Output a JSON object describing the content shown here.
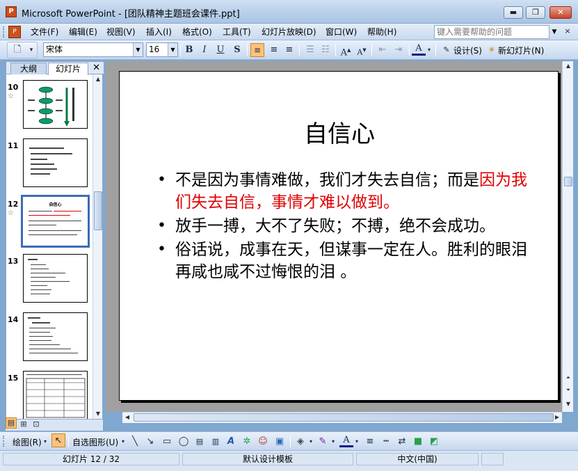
{
  "window": {
    "title": "Microsoft PowerPoint - [团队精神主题班会课件.ppt]",
    "app_icon": "powerpoint-icon",
    "minimize_label": "▬",
    "maximize_label": "❐",
    "close_label": "✕"
  },
  "menu": {
    "items": [
      "文件(F)",
      "编辑(E)",
      "视图(V)",
      "插入(I)",
      "格式(O)",
      "工具(T)",
      "幻灯片放映(D)",
      "窗口(W)",
      "帮助(H)"
    ],
    "help_placeholder": "键入需要帮助的问题"
  },
  "toolbar": {
    "font_name": "宋体",
    "font_size": "16",
    "bold": "B",
    "italic": "I",
    "underline": "U",
    "shadow": "S",
    "design_label": "设计(S)",
    "new_slide_label": "新幻灯片(N)"
  },
  "outline_pane": {
    "tabs": [
      "大纲",
      "幻灯片"
    ],
    "selected_tab": "幻灯片",
    "close_label": "✕",
    "thumbnails": [
      {
        "number": "10",
        "has_star": true
      },
      {
        "number": "11",
        "has_star": false
      },
      {
        "number": "12",
        "has_star": true,
        "selected": true,
        "title": "自信心"
      },
      {
        "number": "13",
        "has_star": false
      },
      {
        "number": "14",
        "has_star": false
      },
      {
        "number": "15",
        "has_star": false
      }
    ]
  },
  "slide": {
    "title": "自信心",
    "bullet1_black": "不是因为事情难做，我们才失去自信；而是",
    "bullet1_red": "因为我们失去自信，事情才难以做到。",
    "bullet2": "放手一搏，大不了失败；不搏，绝不会成功。",
    "bullet3": "俗话说，成事在天，但谋事一定在人。胜利的眼泪再咸也咸不过悔恨的泪 。",
    "accent_red": "#e00000"
  },
  "drawing_toolbar": {
    "draw_label": "绘图(R)",
    "autoshapes_label": "自选图形(U)"
  },
  "status": {
    "slide_info": "幻灯片 12 / 32",
    "template": "默认设计模板",
    "language": "中文(中国)"
  }
}
